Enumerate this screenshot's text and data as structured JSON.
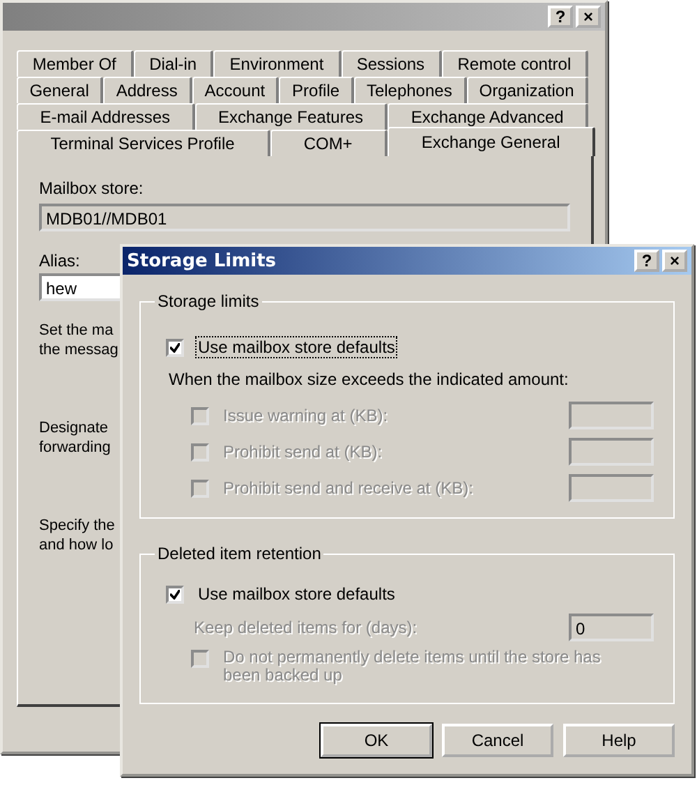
{
  "main_window": {
    "title_buttons": [
      "?",
      "×"
    ],
    "tab_rows": [
      [
        {
          "label": "Member Of",
          "selected": false
        },
        {
          "label": "Dial-in",
          "selected": false
        },
        {
          "label": "Environment",
          "selected": false
        },
        {
          "label": "Sessions",
          "selected": false
        },
        {
          "label": "Remote control",
          "selected": false
        }
      ],
      [
        {
          "label": "General",
          "selected": false
        },
        {
          "label": "Address",
          "selected": false
        },
        {
          "label": "Account",
          "selected": false
        },
        {
          "label": "Profile",
          "selected": false
        },
        {
          "label": "Telephones",
          "selected": false
        },
        {
          "label": "Organization",
          "selected": false
        }
      ],
      [
        {
          "label": "E-mail Addresses",
          "selected": false
        },
        {
          "label": "Exchange Features",
          "selected": false
        },
        {
          "label": "Exchange Advanced",
          "selected": false
        }
      ],
      [
        {
          "label": "Terminal Services Profile",
          "selected": false
        },
        {
          "label": "COM+",
          "selected": false
        },
        {
          "label": "Exchange General",
          "selected": true
        }
      ]
    ],
    "mailbox_store": {
      "label": "Mailbox store:",
      "value": "MDB01//MDB01",
      "disabled": true
    },
    "alias": {
      "label": "Alias:",
      "value": "hew",
      "disabled": false
    },
    "descriptions": [
      "Set the ma\nthe messag",
      "Designate\nforwarding",
      "Specify the\nand how lo"
    ]
  },
  "dialog": {
    "title": "Storage Limits",
    "title_buttons": [
      "?",
      "×"
    ],
    "storage_limits": {
      "title": "Storage limits",
      "use_defaults": {
        "label": "Use mailbox store defaults",
        "checked": true,
        "focused": true
      },
      "note": "When the mailbox size exceeds the indicated amount:",
      "limits": [
        {
          "label": "Issue warning at (KB):",
          "checked": false,
          "disabled": true
        },
        {
          "label": "Prohibit send at (KB):",
          "checked": false,
          "disabled": true
        },
        {
          "label": "Prohibit send and receive at (KB):",
          "checked": false,
          "disabled": true
        }
      ]
    },
    "retention": {
      "title": "Deleted item retention",
      "use_defaults": {
        "label": "Use mailbox store defaults",
        "checked": true,
        "focused": false
      },
      "keep_days": {
        "label": "Keep deleted items for (days):",
        "value": "0",
        "disabled": true
      },
      "do_not_delete": {
        "label": "Do not permanently delete items until the store has been backed up",
        "checked": false,
        "disabled": true
      }
    },
    "buttons": [
      {
        "label": "OK",
        "default": true
      },
      {
        "label": "Cancel",
        "default": false
      },
      {
        "label": "Help",
        "default": false
      }
    ]
  }
}
